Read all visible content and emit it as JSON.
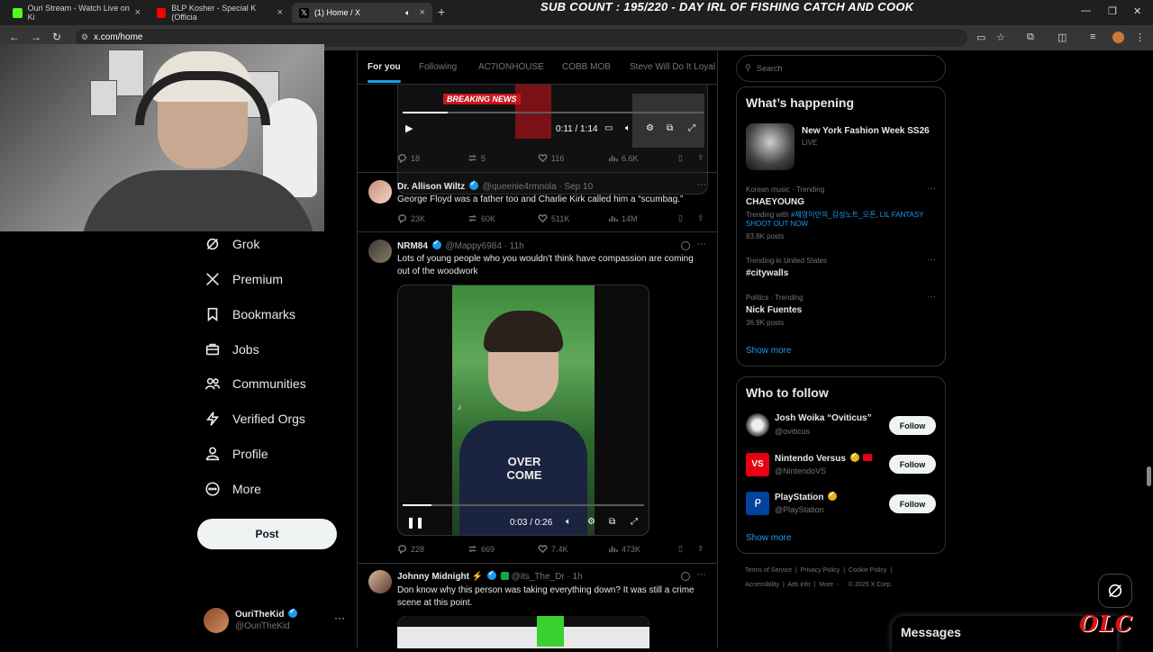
{
  "browser": {
    "tabs": [
      {
        "label": "Ouri Stream - Watch Live on Ki",
        "color": "#53fc18"
      },
      {
        "label": "BLP Kosher - Special K (Officia",
        "color": "#ff0000"
      },
      {
        "label": "(1) Home / X",
        "color": "#ffffff"
      }
    ],
    "url": "x.com/home",
    "overlay_title": "SUB COUNT : 195/220 - DAY IRL OF FISHING CATCH AND COOK"
  },
  "nav": {
    "items": [
      {
        "label": "Grok",
        "icon": "grok-icon"
      },
      {
        "label": "Premium",
        "icon": "x-logo-icon"
      },
      {
        "label": "Bookmarks",
        "icon": "bookmark-icon"
      },
      {
        "label": "Jobs",
        "icon": "briefcase-icon"
      },
      {
        "label": "Communities",
        "icon": "communities-icon"
      },
      {
        "label": "Verified Orgs",
        "icon": "lightning-icon"
      },
      {
        "label": "Profile",
        "icon": "person-icon"
      },
      {
        "label": "More",
        "icon": "more-circle-icon"
      }
    ],
    "post_label": "Post",
    "account": {
      "name": "OuriTheKid",
      "handle": "@OuriTheKid"
    }
  },
  "timeline": {
    "tabs": [
      "For you",
      "Following",
      "AC7IONHOUSE",
      "COBB MOB",
      "Steve Will Do It Loyal"
    ],
    "video1": {
      "breaking": "BREAKING NEWS",
      "time": "0:11 / 1:14",
      "progress": 0.15
    },
    "tweets": [
      {
        "stats": {
          "replies": "18",
          "reposts": "5",
          "likes": "116",
          "views": "6.6K"
        }
      },
      {
        "name": "Dr. Allison Wiltz",
        "handle": "@queenie4rmnola",
        "date": "· Sep 10",
        "text": "George Floyd was a father too and Charlie Kirk called him a “scumbag.”",
        "stats": {
          "replies": "23K",
          "reposts": "60K",
          "likes": "511K",
          "views": "14M"
        }
      },
      {
        "name": "NRM84",
        "handle": "@Mappy6984",
        "date": "· 11h",
        "text": "Lots of young people who you wouldn't think have compassion are coming out of the woodwork",
        "video": {
          "time": "0:03 / 0:26",
          "shirt": "OVER COME",
          "progress": 0.12
        },
        "stats": {
          "replies": "228",
          "reposts": "669",
          "likes": "7.4K",
          "views": "473K"
        }
      },
      {
        "name": "Johnny Midnight",
        "handle": "@its_The_Dr",
        "date": "· 1h",
        "text": "Don know why this person was taking everything down? It was still a crime scene at this point."
      }
    ]
  },
  "sidebar": {
    "search_placeholder": "Search",
    "happening": {
      "title": "What’s happening",
      "featured": {
        "name": "New York Fashion Week SS26",
        "status": "LIVE"
      },
      "trends": [
        {
          "meta": "Korean music · Trending",
          "name": "CHAEYOUNG",
          "extra_prefix": "Trending with",
          "extra_link": "#채영이만의_감성노트_오픈, LIL FANTASY SHOOT OUT NOW",
          "posts": "83.8K posts"
        },
        {
          "meta": "Trending in United States",
          "name": "#citywalls"
        },
        {
          "meta": "Politics · Trending",
          "name": "Nick Fuentes",
          "posts": "36.9K posts"
        }
      ],
      "show_more": "Show more"
    },
    "who_to_follow": {
      "title": "Who to follow",
      "accounts": [
        {
          "name": "Josh Woika “Oviticus”",
          "handle": "@oviticus",
          "button": "Follow"
        },
        {
          "name": "Nintendo Versus",
          "handle": "@NintendoVS",
          "button": "Follow"
        },
        {
          "name": "PlayStation",
          "handle": "@PlayStation",
          "button": "Follow"
        }
      ],
      "show_more": "Show more"
    },
    "footer": {
      "line1": [
        "Terms of Service",
        "Privacy Policy",
        "Cookie Policy"
      ],
      "line2": [
        "Accessibility",
        "Ads info",
        "More ···",
        "© 2025 X Corp."
      ]
    }
  },
  "messages_label": "Messages",
  "watermark": "OLC"
}
